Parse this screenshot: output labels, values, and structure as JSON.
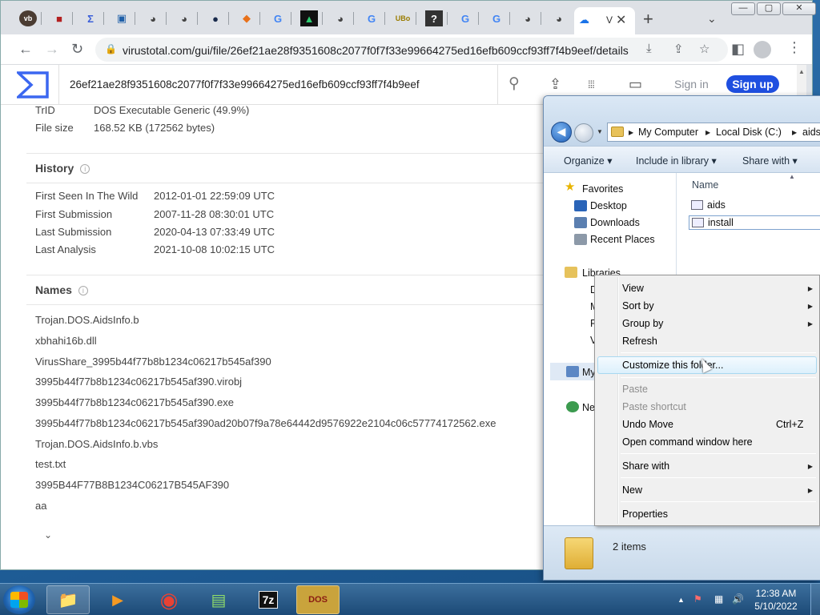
{
  "browser": {
    "tab_glyphs": [
      "vb",
      "■",
      "Σ",
      "▣",
      "◕",
      "◕",
      "●",
      "◆",
      "G",
      "▲",
      "◕",
      "G",
      "UBo",
      "?",
      "G",
      "G",
      "◕",
      "◕"
    ],
    "active_tab": {
      "glyph": "☁",
      "label": "V",
      "close": "✕"
    },
    "newtab": "+",
    "tabdrop": "⌄",
    "window_buttons": {
      "minimize": "—",
      "maximize": "▢",
      "close": "✕"
    },
    "url": "virustotal.com/gui/file/26ef21ae28f9351608c2077f0f7f33e99664275ed16efb609ccf93ff7f4b9eef/details",
    "nav": {
      "back": "←",
      "forward": "→",
      "reload": "↻",
      "lock": "🔒"
    },
    "omnibox_icons": {
      "install": "⤓",
      "share": "⇪",
      "bookmark": "☆"
    },
    "side_panel": "◧",
    "menu": "⋮"
  },
  "virustotal": {
    "search_value": "26ef21ae28f9351608c2077f0f7f33e99664275ed16efb609ccf93ff7f4b9eef",
    "icons": {
      "search": "⚲",
      "upload": "⇪",
      "apps": "⁞⁞⁞",
      "chat": "▭"
    },
    "signin": "Sign in",
    "signup": "Sign up",
    "top_rows": [
      {
        "key": "TrID",
        "value": "DOS Executable Generic (49.9%)"
      },
      {
        "key": "File size",
        "value": "168.52 KB (172562 bytes)"
      }
    ],
    "history": {
      "title": "History",
      "rows": [
        {
          "key": "First Seen In The Wild",
          "value": "2012-01-01 22:59:09 UTC"
        },
        {
          "key": "First Submission",
          "value": "2007-11-28 08:30:01 UTC"
        },
        {
          "key": "Last Submission",
          "value": "2020-04-13 07:33:49 UTC"
        },
        {
          "key": "Last Analysis",
          "value": "2021-10-08 10:02:15 UTC"
        }
      ]
    },
    "names": {
      "title": "Names",
      "items": [
        "Trojan.DOS.AidsInfo.b",
        "xbhahi16b.dll",
        "VirusShare_3995b44f77b8b1234c06217b545af390",
        "3995b44f77b8b1234c06217b545af390.virobj",
        "3995b44f77b8b1234c06217b545af390.exe",
        "3995b44f77b8b1234c06217b545af390ad20b07f9a78e64442d9576922e2104c06c57774172562.exe",
        "Trojan.DOS.AidsInfo.b.vbs",
        "test.txt",
        "3995B44F77B8B1234C06217B545AF390",
        "aa"
      ],
      "expand": "⌄"
    }
  },
  "explorer": {
    "breadcrumb": [
      "My Computer",
      "Local Disk (C:)",
      "aids"
    ],
    "commands": {
      "organize": "Organize ▾",
      "include": "Include in library ▾",
      "share": "Share with ▾"
    },
    "nav": {
      "favorites": "Favorites",
      "desktop": "Desktop",
      "downloads": "Downloads",
      "recent": "Recent Places",
      "libraries": "Libraries",
      "lib_letters": [
        "D",
        "M",
        "P",
        "V"
      ],
      "mycomputer": "My",
      "network": "Ne"
    },
    "column_name": "Name",
    "files": [
      "aids",
      "install"
    ],
    "status": "2 items"
  },
  "context_menu": {
    "view": "View",
    "sort_by": "Sort by",
    "group_by": "Group by",
    "refresh": "Refresh",
    "customize": "Customize this folder...",
    "paste": "Paste",
    "paste_shortcut": "Paste shortcut",
    "undo_move": "Undo Move",
    "undo_shortcut": "Ctrl+Z",
    "open_cmd": "Open command window here",
    "share_with": "Share with",
    "new": "New",
    "properties": "Properties",
    "submenu_arrow": "▶"
  },
  "taskbar": {
    "apps": [
      "📁",
      "▶",
      "◉",
      "▤",
      "7z",
      "DOS"
    ],
    "tray_icons": [
      "▲",
      "⚑",
      "▦",
      "🔊"
    ],
    "time": "12:38 AM",
    "date": "5/10/2022"
  },
  "colors": {
    "vt_blue": "#1f4fe0",
    "win_blue": "#1f5d97"
  }
}
